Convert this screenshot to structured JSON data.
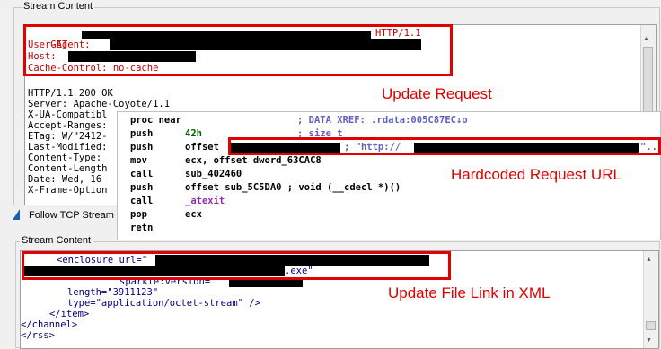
{
  "top_group": {
    "label": "Stream Content"
  },
  "request": {
    "get_method": "GET",
    "http_version": "HTTP/1.1",
    "user_agent_key": "User-Agent:",
    "host_key": "Host:",
    "cache_control": "Cache-Control: no-cache"
  },
  "response": {
    "lines": [
      "HTTP/1.1 200 OK",
      "Server: Apache-Coyote/1.1",
      "X-UA-Compatibl",
      "Accept-Ranges:",
      "ETag: W/\"2412-",
      "Last-Modified:",
      "Content-Type: ",
      "Content-Length",
      "Date: Wed, 16 ",
      "X-Frame-Option"
    ]
  },
  "disasm": {
    "proc": "proc near",
    "xref": "; DATA XREF: .rdata:005C87EC↓o",
    "rows": [
      {
        "mn": "push",
        "op": "42h",
        "cmt": "; size_t"
      },
      {
        "mn": "push",
        "op": "offset",
        "cmt": "; \"http://"
      },
      {
        "mn": "mov",
        "op": "ecx, offset dword_63CAC8",
        "cmt": ""
      },
      {
        "mn": "call",
        "op": "sub_402460",
        "cmt": ""
      },
      {
        "mn": "push",
        "op": "offset sub_5C5DA0 ; void (__cdecl *)()",
        "cmt": ""
      },
      {
        "mn": "call",
        "op": "_atexit",
        "cmt": ""
      },
      {
        "mn": "pop",
        "op": "ecx",
        "cmt": ""
      },
      {
        "mn": "retn",
        "op": "",
        "cmt": ""
      }
    ],
    "url_tail": "\"..."
  },
  "tcp_window": {
    "title": "Follow TCP Stream"
  },
  "bottom_group": {
    "label": "Stream Content"
  },
  "xml": {
    "enclosure": "<enclosure url=\"",
    "exe": ".exe\"",
    "sparkle": "sparkle:version=\"",
    "length": "length=\"3911123\"",
    "type": "type=\"application/octet-stream\" />",
    "item_close": "</item>",
    "channel_close": "</channel>",
    "rss_close": "</rss>"
  },
  "annotations": {
    "update_request": "Update Request",
    "hardcoded_url": "Hardcoded Request URL",
    "update_file": "Update File Link in XML"
  }
}
